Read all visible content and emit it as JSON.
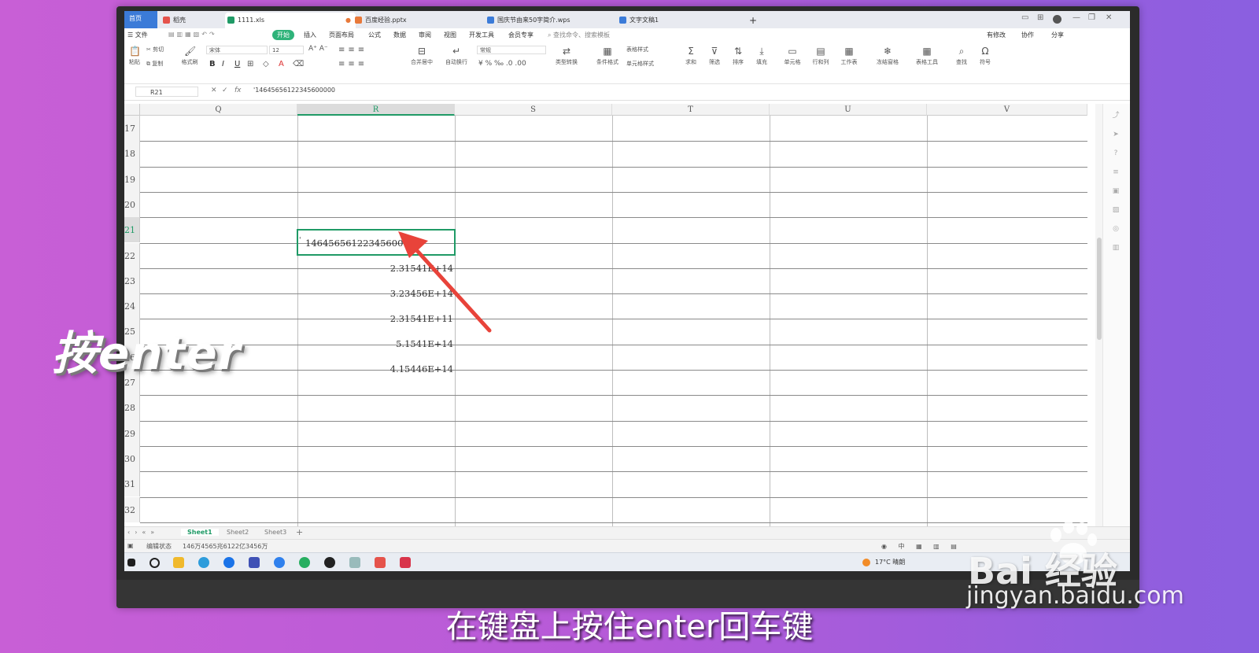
{
  "tabs": {
    "home": "首页",
    "items": [
      {
        "label": "稻壳",
        "color": "#e5534b"
      },
      {
        "label": "1111.xls",
        "color": "#1f9a66"
      },
      {
        "label": "百度经验.pptx",
        "color": "#e8793a"
      },
      {
        "label": "国庆节由来50字简介.wps",
        "color": "#3b7bd8"
      },
      {
        "label": "文字文稿1",
        "color": "#3b7bd8"
      }
    ],
    "add": "+"
  },
  "menubar": {
    "file": "☰ 文件",
    "items": [
      "开始",
      "插入",
      "页面布局",
      "公式",
      "数据",
      "审阅",
      "视图",
      "开发工具",
      "会员专享"
    ],
    "search": "查找命令、搜索模板",
    "right": [
      "有修改",
      "协作",
      "分享"
    ]
  },
  "ribbon": {
    "paste": "粘贴",
    "cut": "剪切",
    "copy": "复制",
    "format_painter": "格式刷",
    "font_name": "宋体",
    "font_size": "12",
    "bold": "B",
    "italic": "I",
    "underline": "U",
    "merge": "合并居中",
    "wrap": "自动换行",
    "number_format": "常规",
    "convert": "类型转换",
    "conditional": "条件格式",
    "table_style": "表格样式",
    "cell_style": "单元格样式",
    "sum": "求和",
    "filter": "筛选",
    "sort": "排序",
    "fill": "填充",
    "cell": "单元格",
    "rowcol": "行和列",
    "worksheet": "工作表",
    "freeze": "冻结窗格",
    "table_tools": "表格工具",
    "find": "查找",
    "symbol": "符号"
  },
  "formula_bar": {
    "cell_ref": "R21",
    "fx": "fx",
    "content": "'14645656122345600000"
  },
  "grid": {
    "columns": [
      "Q",
      "R",
      "S",
      "T",
      "U",
      "V"
    ],
    "selected_column": "R",
    "rows": [
      "17",
      "18",
      "19",
      "20",
      "21",
      "22",
      "23",
      "24",
      "25",
      "26",
      "27",
      "28",
      "29",
      "30",
      "31",
      "32"
    ],
    "selected_row": "21",
    "cells": {
      "R21": "14645656122345600000",
      "R22": "2.31541E+14",
      "R23": "3.23456E+14",
      "R24": "2.31541E+11",
      "R25": "5.1541E+14",
      "R26": "4.15446E+14"
    },
    "quote_mark": "'"
  },
  "sheets": [
    "Sheet1",
    "Sheet2",
    "Sheet3"
  ],
  "active_sheet": "Sheet1",
  "status": {
    "mode": "编辑状态",
    "value": "146万4565兆6122亿3456万"
  },
  "taskbar": {
    "weather": "17°C 晴朗"
  },
  "overlay_text": "按enter",
  "caption": "在键盘上按住enter回车键",
  "watermark": {
    "logo": "Bai 经验",
    "url": "jingyan.baidu.com"
  }
}
